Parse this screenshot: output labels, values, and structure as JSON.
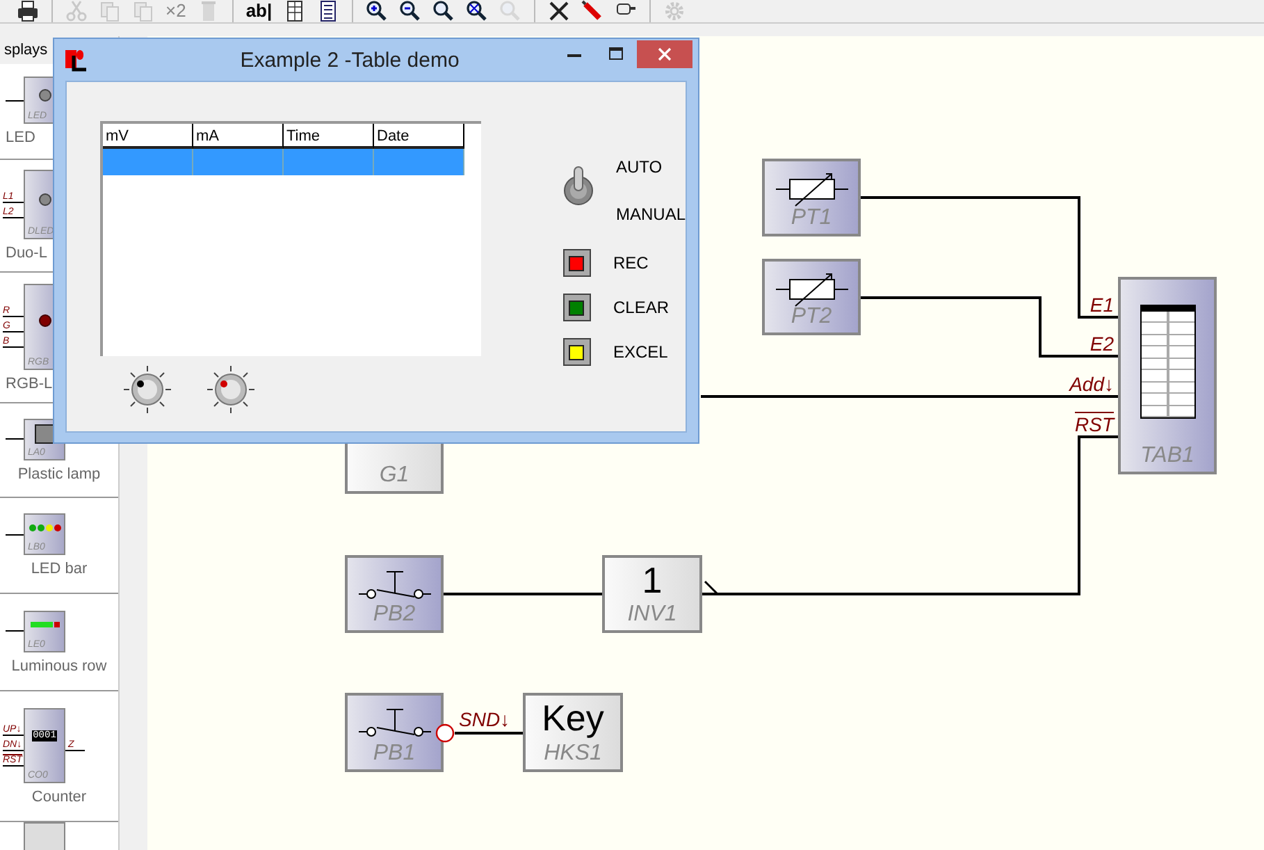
{
  "toolbar": {
    "items": [
      {
        "kind": "icon",
        "disabled": false
      },
      {
        "kind": "sep"
      },
      {
        "kind": "icon",
        "disabled": true
      },
      {
        "kind": "icon",
        "disabled": true
      },
      {
        "kind": "icon",
        "disabled": true
      },
      {
        "kind": "text",
        "label": "×2",
        "disabled": true
      },
      {
        "kind": "icon",
        "disabled": true
      },
      {
        "kind": "sep"
      },
      {
        "kind": "text",
        "label": "ab|",
        "disabled": false
      },
      {
        "kind": "icon",
        "disabled": false
      },
      {
        "kind": "icon",
        "disabled": false
      },
      {
        "kind": "sep"
      },
      {
        "kind": "icon",
        "disabled": false
      },
      {
        "kind": "icon",
        "disabled": false
      },
      {
        "kind": "icon",
        "disabled": false
      },
      {
        "kind": "icon",
        "disabled": false
      },
      {
        "kind": "icon",
        "disabled": true
      },
      {
        "kind": "sep"
      },
      {
        "kind": "icon",
        "disabled": false
      },
      {
        "kind": "icon",
        "disabled": false
      },
      {
        "kind": "icon",
        "disabled": false
      },
      {
        "kind": "sep"
      },
      {
        "kind": "icon",
        "disabled": true
      }
    ]
  },
  "palette": {
    "dropdown": "splays",
    "items": [
      {
        "kind": "led",
        "label": "LED",
        "tag": "LED"
      },
      {
        "kind": "duo",
        "label": "Duo-L",
        "tag": "DLED",
        "pins": [
          {
            "label": "L1",
            "inverted": false
          },
          {
            "label": "L2",
            "inverted": false
          }
        ]
      },
      {
        "kind": "rgb",
        "label": "RGB-L",
        "tag": "RGB",
        "pins": [
          {
            "label": "R",
            "inverted": false
          },
          {
            "label": "G",
            "inverted": false
          },
          {
            "label": "B",
            "inverted": false
          }
        ]
      },
      {
        "kind": "lamp",
        "label": "Plastic lamp",
        "tag": "LA0"
      },
      {
        "kind": "bar",
        "label": "LED bar",
        "tag": "LB0"
      },
      {
        "kind": "row",
        "label": "Luminous row",
        "tag": "LE0"
      },
      {
        "kind": "counter",
        "label": "Counter",
        "tag": "CO0",
        "display": "0001",
        "pins": [
          {
            "label": "UP↓",
            "inverted": false
          },
          {
            "label": "DN↓",
            "inverted": false
          },
          {
            "label": "RST",
            "inverted": true
          }
        ],
        "output": "Z"
      },
      {
        "kind": "screen"
      }
    ]
  },
  "canvas": {
    "nodes": [
      {
        "kind": "resistor",
        "label": "PT1"
      },
      {
        "kind": "resistor",
        "label": "PT2"
      },
      {
        "kind": "table",
        "label": "TAB1",
        "pins": [
          {
            "label": "E1",
            "inverted": false
          },
          {
            "label": "E2",
            "inverted": false
          },
          {
            "label": "Add↓",
            "inverted": false
          },
          {
            "label": "RST",
            "inverted": true
          }
        ]
      },
      {
        "kind": "gate",
        "label": "G1"
      },
      {
        "kind": "switch",
        "label": "PB2"
      },
      {
        "kind": "inverter",
        "label": "INV1",
        "symbol": "1"
      },
      {
        "kind": "switch",
        "label": "PB1",
        "output": "SND↓"
      },
      {
        "kind": "key",
        "label": "HKS1",
        "symbol": "Key"
      }
    ]
  },
  "dialog": {
    "title": "Example 2 -Table demo",
    "table": {
      "columns": [
        "mV",
        "mA",
        "Time",
        "Date"
      ],
      "rows": [
        {
          "selected": true
        }
      ]
    },
    "knobs": [
      {
        "color": "#000000"
      },
      {
        "color": "#d00000"
      }
    ],
    "toggle": {
      "on": true,
      "labels": [
        "AUTO",
        "MANUAL"
      ]
    },
    "buttons": [
      {
        "label": "REC",
        "color": "#ff0000"
      },
      {
        "label": "CLEAR",
        "color": "#008000"
      },
      {
        "label": "EXCEL",
        "color": "#ffff00"
      }
    ]
  }
}
